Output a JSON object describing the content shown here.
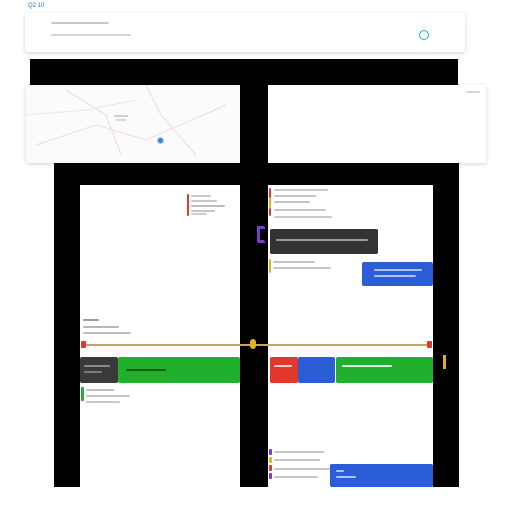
{
  "window": {
    "title": "Q2 10"
  },
  "colors": {
    "frame": "#000000",
    "accent_blue": "#2b5ed6",
    "accent_green": "#20b02b",
    "accent_red": "#e1382b",
    "dark_bar": "#333333",
    "gold": "#e0b020",
    "purple": "#7a3ad0",
    "cyan": "#32b4c8"
  },
  "icons": [
    "status-dot-icon",
    "map-pin-icon",
    "timeline-node-icon",
    "bracket-icon"
  ]
}
